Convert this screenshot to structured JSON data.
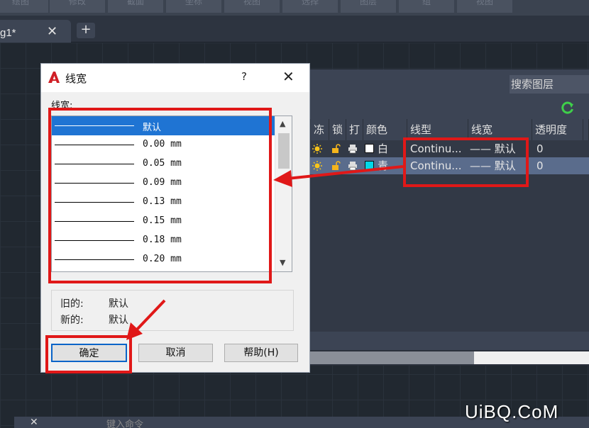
{
  "ribbon": {
    "tabs": [
      "绘图",
      "修改",
      "截面",
      "坐标",
      "视图",
      "选择",
      "图层",
      "组",
      "视图"
    ]
  },
  "doctab": {
    "label": "g1*",
    "close": "✕",
    "new": "+"
  },
  "layer_panel": {
    "search_placeholder": "搜索图层",
    "columns": [
      "冻",
      "锁",
      "打",
      "颜色",
      "线型",
      "线宽",
      "透明度"
    ],
    "rows": [
      {
        "color_name": "白",
        "color_hex": "#ffffff",
        "linetype": "Continu...",
        "lineweight": "—— 默认",
        "transparency": "0",
        "selected": false
      },
      {
        "color_name": "青",
        "color_hex": "#00d8e8",
        "linetype": "Continu...",
        "lineweight": "—— 默认",
        "transparency": "0",
        "selected": true
      }
    ]
  },
  "dialog": {
    "title": "线宽",
    "help": "?",
    "close": "✕",
    "list_label": "线宽:",
    "items": [
      "默认",
      "0.00 mm",
      "0.05 mm",
      "0.09 mm",
      "0.13 mm",
      "0.15 mm",
      "0.18 mm",
      "0.20 mm"
    ],
    "selected_index": 0,
    "old_label": "旧的:",
    "old_value": "默认",
    "new_label": "新的:",
    "new_value": "默认",
    "ok": "确定",
    "cancel": "取消",
    "help_button": "帮助(H)"
  },
  "command_line": {
    "close": "✕",
    "placeholder": "键入命令"
  },
  "watermark": "UiBQ.CoM",
  "colors": {
    "accent_selection": "#1f74d3",
    "annotation_red": "#e01818"
  }
}
